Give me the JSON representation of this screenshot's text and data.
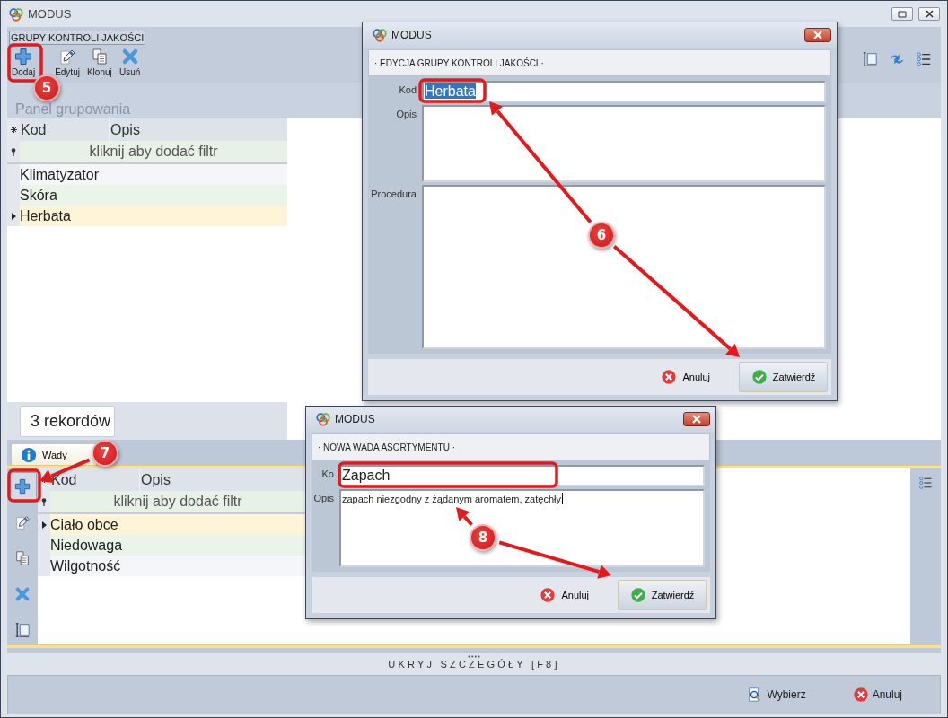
{
  "window": {
    "title": "MODUS"
  },
  "ribbon": {
    "group_label": "GRUPY KONTROLI JAKOŚCI",
    "buttons": [
      {
        "label": "Dodaj",
        "kind": "add"
      },
      {
        "label": "Edytuj",
        "kind": "edit"
      },
      {
        "label": "Klonuj",
        "kind": "clone"
      },
      {
        "label": "Usuń",
        "kind": "delete"
      }
    ],
    "right_tools": [
      {
        "kind": "columns"
      },
      {
        "kind": "refresh"
      },
      {
        "kind": "list"
      }
    ]
  },
  "group_panel": {
    "hint": "Panel grupowania"
  },
  "groups_grid": {
    "columns": [
      "Kod",
      "Opis"
    ],
    "filter_hint": "kliknij aby dodać filtr",
    "rows": [
      {
        "kod": "Klimatyzator",
        "selected": false
      },
      {
        "kod": "Skóra",
        "selected": false
      },
      {
        "kod": "Herbata",
        "selected": true
      }
    ]
  },
  "record_count": "3 rekordów",
  "details": {
    "tabs": [
      {
        "label": "Wady",
        "selected": true
      }
    ],
    "tools": [
      {
        "kind": "add"
      },
      {
        "kind": "edit"
      },
      {
        "kind": "clone"
      },
      {
        "kind": "delete"
      },
      {
        "kind": "columns"
      }
    ],
    "right_tools": [
      {
        "kind": "list"
      }
    ],
    "grid": {
      "columns": [
        "Kod",
        "Opis"
      ],
      "filter_hint": "kliknij aby dodać filtr",
      "rows": [
        {
          "kod": "Ciało obce",
          "selected": true
        },
        {
          "kod": "Niedowaga",
          "selected": false
        },
        {
          "kod": "Wilgotność",
          "selected": false
        }
      ]
    }
  },
  "details_toggle": "UKRYJ SZCZEGÓŁY [F8]",
  "footer_buttons": [
    {
      "label": "Wybierz",
      "kind": "select"
    },
    {
      "label": "Anuluj",
      "kind": "cancel"
    }
  ],
  "dialogs": [
    {
      "title": "MODUS",
      "header": "· EDYCJA GRUPY KONTROLI JAKOŚCI ·",
      "fields": [
        {
          "label": "Kod",
          "kind": "line",
          "value": "Herbata",
          "text_selected": true
        },
        {
          "label": "Opis",
          "kind": "area"
        },
        {
          "label": "Procedura",
          "kind": "area"
        }
      ],
      "buttons": [
        {
          "label": "Anuluj",
          "kind": "cancel"
        },
        {
          "label": "Zatwierdź",
          "kind": "confirm"
        }
      ]
    },
    {
      "title": "MODUS",
      "header": "· NOWA WADA ASORTYMENTU ·",
      "fields": [
        {
          "label": "Ko",
          "kind": "line",
          "value": "Zapach",
          "text_selected": false
        },
        {
          "label": "Opis",
          "kind": "area",
          "value": "zapach niezgodny z żądanym aromatem, zatęchły"
        }
      ],
      "buttons": [
        {
          "label": "Anuluj",
          "kind": "cancel"
        },
        {
          "label": "Zatwierdź",
          "kind": "confirm"
        }
      ]
    }
  ],
  "annotations": [
    {
      "label": "5"
    },
    {
      "label": "6"
    },
    {
      "label": "7"
    },
    {
      "label": "8"
    }
  ]
}
